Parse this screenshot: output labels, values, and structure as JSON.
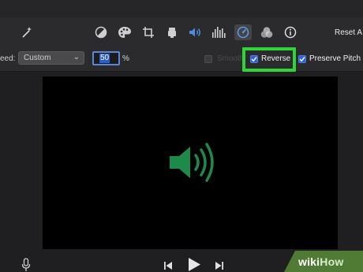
{
  "toolbar": {
    "reset_all_label": "Reset A",
    "icons": [
      "magic-wand-icon",
      "color-balance-icon",
      "color-palette-icon",
      "crop-icon",
      "stabilization-camera-icon",
      "volume-icon",
      "equalizer-icon",
      "speed-gauge-icon",
      "clip-filter-icon",
      "info-icon"
    ],
    "active_icon": "speed-gauge-icon"
  },
  "speed": {
    "label": "eed:",
    "preset_value": "Custom",
    "percent_value": "50",
    "percent_sign": "%",
    "smooth_label": "Smooth",
    "smooth_checked": false,
    "reverse_label": "Reverse",
    "reverse_checked": true,
    "preserve_pitch_label": "Preserve Pitch",
    "preserve_pitch_checked": true
  },
  "viewer": {
    "content_icon": "speaker-sound-icon",
    "icon_color": "#1d8a4a"
  },
  "playback": {
    "icons": [
      "microphone-icon",
      "skip-back-icon",
      "play-icon",
      "skip-forward-icon"
    ]
  },
  "watermark": {
    "prefix": "wiki",
    "suffix": "How"
  },
  "colors": {
    "highlight": "#2fd536",
    "checkbox_accent": "#2f62d4",
    "selection": "#2d5ec9"
  }
}
